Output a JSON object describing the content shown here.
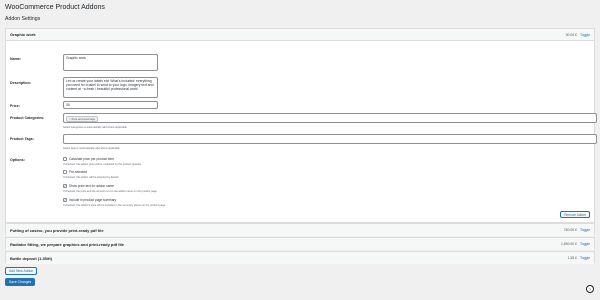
{
  "page_title": "WooCommerce Product Addons",
  "section_title": "Addon Settings",
  "addons": [
    {
      "title": "Graphic work",
      "price": "30.00 £",
      "toggle": "Toggle",
      "expanded": true,
      "fields": {
        "name_label": "Name:",
        "name_value": "Graphic work",
        "description_label": "Description:",
        "description_value": "Let us create your labels etc! What's included: everything you need for a label to send to your logo, imagery text and content at ~a fresh / beautiful professional work!",
        "price_label": "Price:",
        "price_value": "30",
        "categories_label": "Product Categories:",
        "category_tag": "Pets and feed tags",
        "categories_help": "Select categories to automatically add where applicable",
        "tags_label": "Product Tags:",
        "tags_help": "Select tags to automatically add where applicable",
        "options_label": "Options:",
        "options": [
          {
            "label": "Calculate price per product item",
            "checked": false,
            "help": "If checked, this addon price will be multiplied by the product quantity"
          },
          {
            "label": "Pre-selected",
            "checked": false,
            "help": "If checked, this addon will be selected by default"
          },
          {
            "label": "Show price text for addon name",
            "checked": true,
            "help": "If checked, the price and the amount next to the addon name on the product page"
          },
          {
            "label": "Include in product page summary",
            "checked": true,
            "help": "If checked, this addon's price will be included in the summary shown on the product page"
          }
        ],
        "remove_label": "Remove Addon"
      }
    },
    {
      "title": "Putting of casino, you provide print-ready pdf file",
      "price": "780.00 £",
      "toggle": "Toggle",
      "expanded": false
    },
    {
      "title": "Radiator fitting, we prepare graphics and print-ready pdf file",
      "price": "1,650.00 £",
      "toggle": "Toggle",
      "expanded": false
    },
    {
      "title": "Bottle deposit (1.35/ft)",
      "price": "1.35 £",
      "toggle": "Toggle",
      "expanded": false
    }
  ],
  "add_button_label": "Add New Addon",
  "save_button_label": "Save Changes",
  "help_icon": "?",
  "colors": {
    "accent": "#2271b1",
    "background": "#f0f0f1"
  }
}
